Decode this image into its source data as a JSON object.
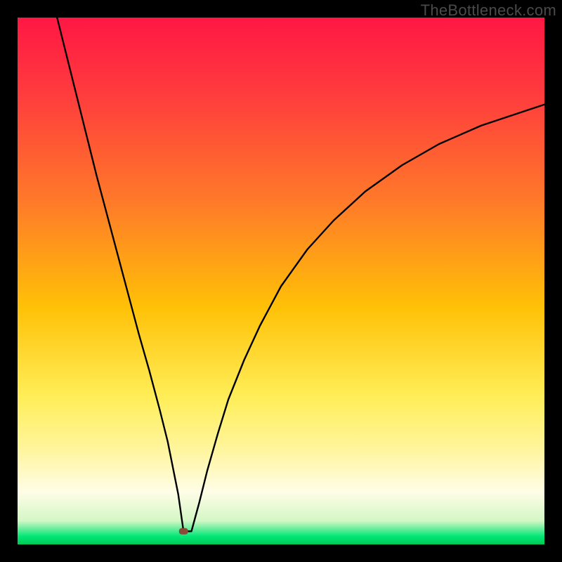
{
  "watermark": "TheBottleneck.com",
  "chart_data": {
    "type": "line",
    "title": "",
    "xlabel": "",
    "ylabel": "",
    "xlim": [
      0,
      100
    ],
    "ylim": [
      0,
      100
    ],
    "grid": false,
    "legend": false,
    "background_gradient": {
      "stops": [
        {
          "offset": 0.0,
          "color": "#ff1744"
        },
        {
          "offset": 0.15,
          "color": "#ff3d3d"
        },
        {
          "offset": 0.35,
          "color": "#ff7a29"
        },
        {
          "offset": 0.55,
          "color": "#ffc107"
        },
        {
          "offset": 0.72,
          "color": "#ffee58"
        },
        {
          "offset": 0.82,
          "color": "#fff59d"
        },
        {
          "offset": 0.9,
          "color": "#fffde7"
        },
        {
          "offset": 0.955,
          "color": "#d4f7c5"
        },
        {
          "offset": 0.985,
          "color": "#00e676"
        },
        {
          "offset": 1.0,
          "color": "#00c853"
        }
      ]
    },
    "marker": {
      "x": 31.5,
      "y": 2.5,
      "color": "#8a4a3a"
    },
    "series": [
      {
        "name": "curve",
        "color": "#000000",
        "x": [
          7.5,
          9,
          11,
          13,
          15,
          17,
          19,
          21,
          23,
          25,
          27,
          28.5,
          29.5,
          30.5,
          31.5,
          33,
          34.5,
          36,
          38,
          40,
          43,
          46,
          50,
          55,
          60,
          66,
          73,
          80,
          88,
          100
        ],
        "y": [
          100,
          94,
          86,
          78,
          70,
          62.5,
          55,
          47.5,
          40,
          33,
          25.5,
          19.5,
          14.5,
          9.5,
          2.5,
          2.5,
          8,
          14,
          21,
          27.5,
          35,
          41.5,
          49,
          56,
          61.5,
          67,
          72,
          76,
          79.5,
          83.5
        ]
      }
    ]
  }
}
